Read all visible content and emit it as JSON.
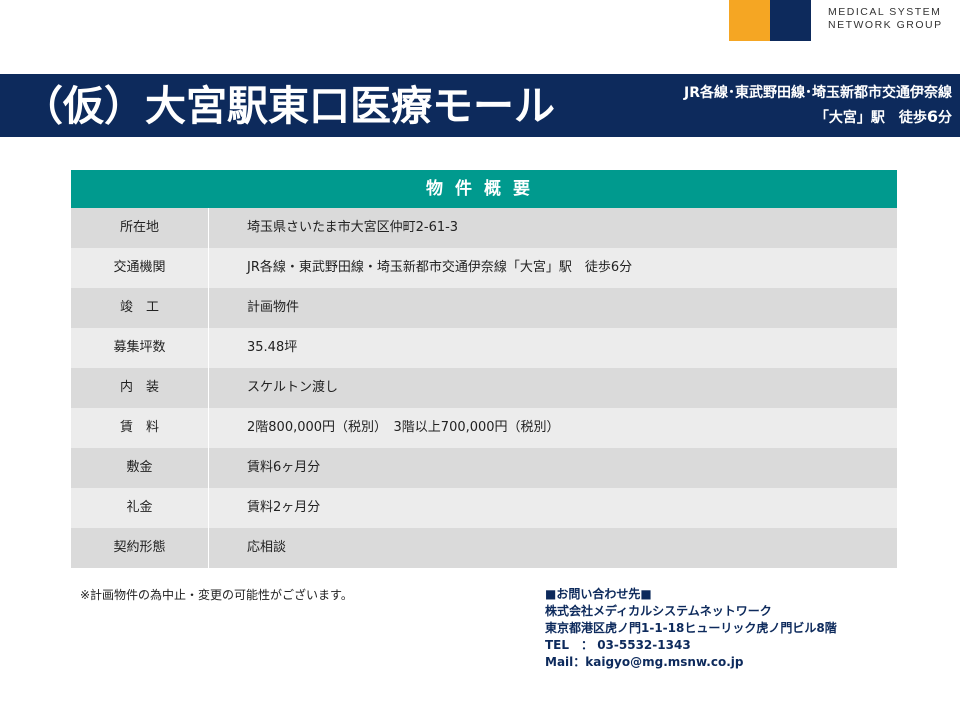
{
  "logo": {
    "line1": "MEDICAL SYSTEM",
    "line2": "NETWORK GROUP",
    "colors": {
      "orange": "#f5a623",
      "navy": "#0d2a5c"
    }
  },
  "banner": {
    "title": "（仮）大宮駅東口医療モール",
    "access_line1": "JR各線･東武野田線･埼玉新都市交通伊奈線",
    "access_line2_prefix": "「大宮」駅　徒歩",
    "access_walk_minutes": "6",
    "access_walk_unit": "分"
  },
  "overview": {
    "header": "物件概要",
    "rows": [
      {
        "label": "所在地",
        "value": "埼玉県さいたま市大宮区仲町2-61-3"
      },
      {
        "label": "交通機関",
        "value": "JR各線・東武野田線・埼玉新都市交通伊奈線「大宮」駅　徒歩6分"
      },
      {
        "label": "竣　工",
        "value": "計画物件"
      },
      {
        "label": "募集坪数",
        "value": "35.48坪"
      },
      {
        "label": "内　装",
        "value": "スケルトン渡し"
      },
      {
        "label": "賃　料",
        "value": "2階800,000円（税別）　3階以上700,000円（税別）"
      },
      {
        "label": "敷金",
        "value": "賃料6ヶ月分"
      },
      {
        "label": "礼金",
        "value": "賃料2ヶ月分"
      },
      {
        "label": "契約形態",
        "value": "応相談"
      }
    ]
  },
  "footer": {
    "note": "※計画物件の為中止・変更の可能性がございます。",
    "contact_heading": "■お問い合わせ先■",
    "company": "株式会社メディカルシステムネットワーク",
    "address": "東京都港区虎ノ門1-1-18ヒューリック虎ノ門ビル8階",
    "tel": "TEL　：  03-5532-1343",
    "mail": "Mail：kaigyo@mg.msnw.co.jp"
  }
}
